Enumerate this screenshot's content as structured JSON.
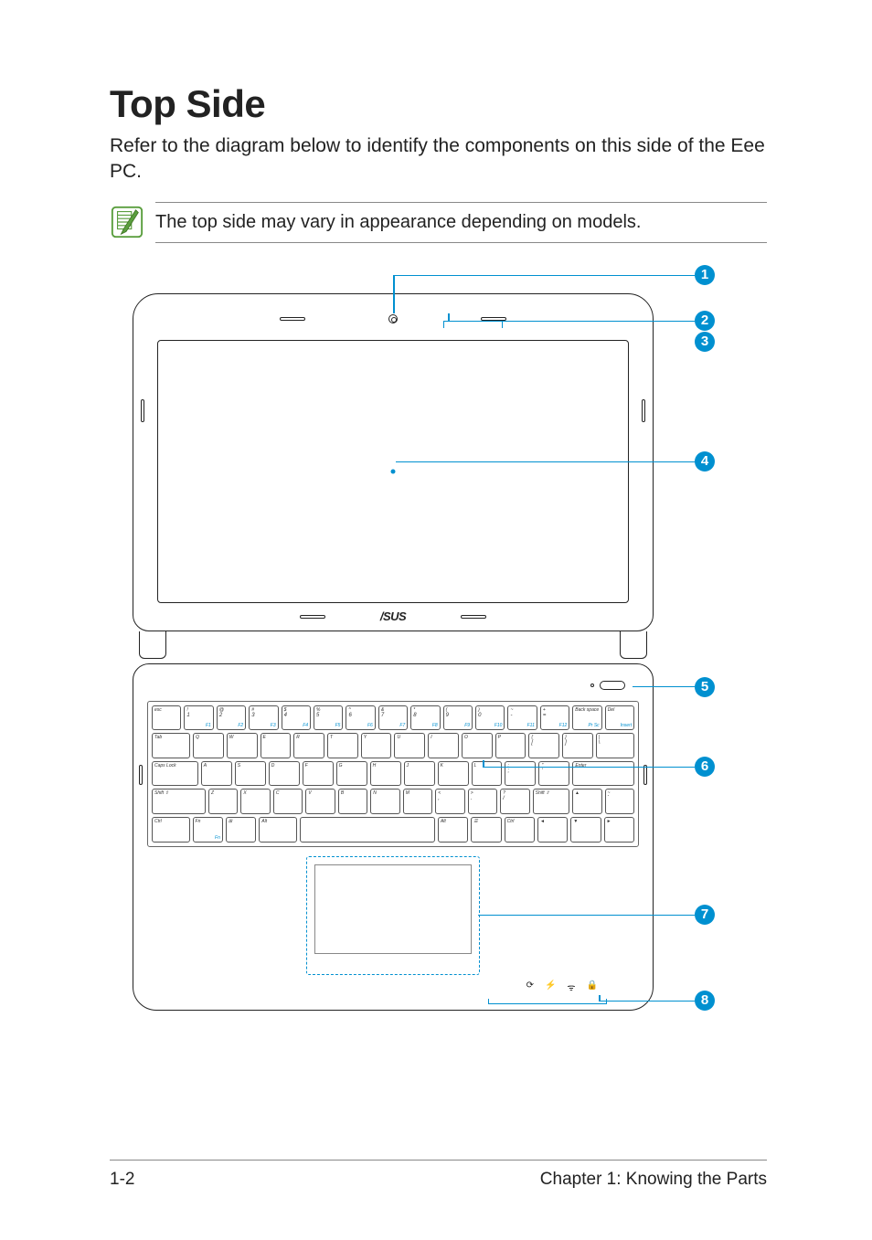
{
  "title": "Top Side",
  "intro": "Refer to the diagram below to identify the components on this side of the Eee PC.",
  "note": "The top side may vary in appearance depending on models.",
  "logo": "/SUS",
  "callouts": [
    "1",
    "2",
    "3",
    "4",
    "5",
    "6",
    "7",
    "8"
  ],
  "keyboard": {
    "row1": [
      {
        "t": "esc",
        "s": ""
      },
      {
        "t": "!",
        "m": "1",
        "s": "F1"
      },
      {
        "t": "@",
        "m": "2",
        "s": "F2"
      },
      {
        "t": "#",
        "m": "3",
        "s": "F3"
      },
      {
        "t": "$",
        "m": "4",
        "s": "F4"
      },
      {
        "t": "%",
        "m": "5",
        "s": "F5"
      },
      {
        "t": "^",
        "m": "6",
        "s": "F6"
      },
      {
        "t": "&",
        "m": "7",
        "s": "F7"
      },
      {
        "t": "*",
        "m": "8",
        "s": "F8"
      },
      {
        "t": "(",
        "m": "9",
        "s": "F9"
      },
      {
        "t": ")",
        "m": "0",
        "s": "F10"
      },
      {
        "t": "~",
        "m": "-",
        "s": "F11"
      },
      {
        "t": "+",
        "m": "=",
        "s": "F12"
      },
      {
        "t": "Back space",
        "s": "Pr Sc"
      },
      {
        "t": "Del",
        "s": "Insert"
      }
    ],
    "row2": [
      {
        "t": "Tab",
        "w": 1.3
      },
      {
        "t": "Q"
      },
      {
        "t": "W"
      },
      {
        "t": "E"
      },
      {
        "t": "R"
      },
      {
        "t": "T"
      },
      {
        "t": "Y"
      },
      {
        "t": "U"
      },
      {
        "t": "I"
      },
      {
        "t": "O"
      },
      {
        "t": "P"
      },
      {
        "t": "{",
        "m": "["
      },
      {
        "t": "}",
        "m": "]"
      },
      {
        "t": "|",
        "m": "\\",
        "w": 1.3
      }
    ],
    "row3": [
      {
        "t": "Caps Lock",
        "w": 1.6
      },
      {
        "t": "A"
      },
      {
        "t": "S"
      },
      {
        "t": "D"
      },
      {
        "t": "F"
      },
      {
        "t": "G"
      },
      {
        "t": "H"
      },
      {
        "t": "J"
      },
      {
        "t": "K"
      },
      {
        "t": "L"
      },
      {
        "t": ":",
        "m": ";"
      },
      {
        "t": "\"",
        "m": "'"
      },
      {
        "t": "Enter",
        "w": 2.2
      }
    ],
    "row4": [
      {
        "t": "Shift ⇧",
        "w": 2
      },
      {
        "t": "Z"
      },
      {
        "t": "X"
      },
      {
        "t": "C"
      },
      {
        "t": "V"
      },
      {
        "t": "B"
      },
      {
        "t": "N"
      },
      {
        "t": "M"
      },
      {
        "t": "<",
        "m": ","
      },
      {
        "t": ">",
        "m": "."
      },
      {
        "t": "?",
        "m": "/"
      },
      {
        "t": "Shift ⇧",
        "w": 1.3
      },
      {
        "t": "▲"
      },
      {
        "t": "~",
        "m": "`"
      }
    ],
    "row5": [
      {
        "t": "Ctrl",
        "w": 1.3
      },
      {
        "t": "Fn",
        "s": "Fn"
      },
      {
        "t": "⊞"
      },
      {
        "t": "Alt",
        "w": 1.3
      },
      {
        "t": "",
        "w": 5.2
      },
      {
        "t": "Alt"
      },
      {
        "t": "☰"
      },
      {
        "t": "Ctrl"
      },
      {
        "t": "◄"
      },
      {
        "t": "▼"
      },
      {
        "t": "►"
      }
    ]
  },
  "status_icons": [
    "⟳",
    "⚡",
    "ᯤ",
    "🔒"
  ],
  "footer": {
    "left": "1-2",
    "right": "Chapter 1: Knowing the Parts"
  }
}
